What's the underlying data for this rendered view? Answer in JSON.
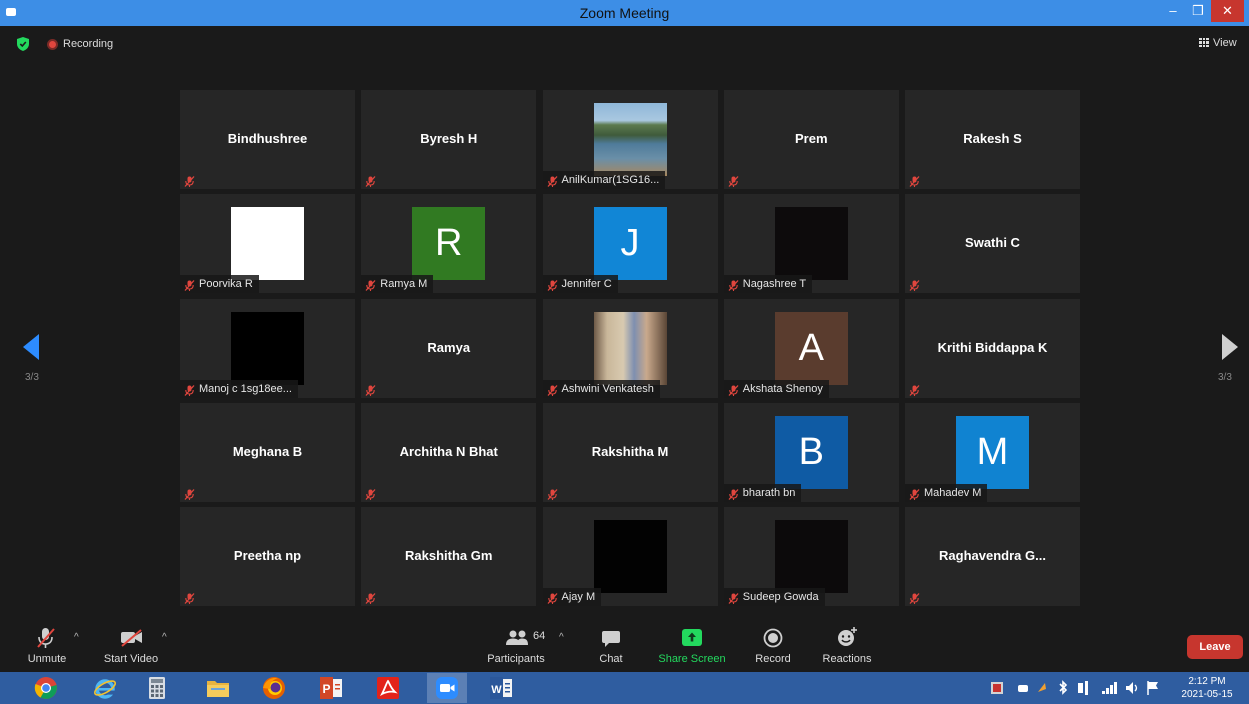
{
  "window": {
    "title": "Zoom Meeting",
    "minimize_label": "–",
    "maximize_label": "❒",
    "close_label": "✕"
  },
  "top_bar": {
    "recording_label": "Recording",
    "view_label": "View"
  },
  "pagination": {
    "left_label": "3/3",
    "right_label": "3/3"
  },
  "participants": [
    {
      "name": "Bindhushree",
      "display": "name"
    },
    {
      "name": "Byresh H",
      "display": "name"
    },
    {
      "name": "AnilKumar(1SG16...",
      "display": "photo"
    },
    {
      "name": "Prem",
      "display": "name"
    },
    {
      "name": "Rakesh S",
      "display": "name"
    },
    {
      "name": "Poorvika R",
      "display": "color",
      "color": "#ffffff"
    },
    {
      "name": "Ramya M",
      "display": "letter",
      "letter": "R",
      "color": "#317a22"
    },
    {
      "name": "Jennifer C",
      "display": "letter",
      "letter": "J",
      "color": "#1186d6"
    },
    {
      "name": "Nagashree T",
      "display": "color",
      "color": "#0d0b0c"
    },
    {
      "name": "Swathi C",
      "display": "name"
    },
    {
      "name": "Manoj c 1sg18ee...",
      "display": "color",
      "color": "#000000"
    },
    {
      "name": "Ramya",
      "display": "name"
    },
    {
      "name": "Ashwini Venkatesh",
      "display": "photo"
    },
    {
      "name": "Akshata Shenoy",
      "display": "letter",
      "letter": "A",
      "color": "#5a3c2e"
    },
    {
      "name": "Krithi Biddappa K",
      "display": "name"
    },
    {
      "name": "Meghana B",
      "display": "name"
    },
    {
      "name": "Architha N Bhat",
      "display": "name"
    },
    {
      "name": "Rakshitha M",
      "display": "name"
    },
    {
      "name": "bharath bn",
      "display": "letter",
      "letter": "B",
      "color": "#0f5ba4"
    },
    {
      "name": "Mahadev M",
      "display": "letter",
      "letter": "M",
      "color": "#1083d1"
    },
    {
      "name": "Preetha np",
      "display": "name"
    },
    {
      "name": "Rakshitha Gm",
      "display": "name"
    },
    {
      "name": "Ajay M",
      "display": "color",
      "color": "#020202"
    },
    {
      "name": "Sudeep Gowda",
      "display": "color",
      "color": "#0c0a0b"
    },
    {
      "name": "Raghavendra  G...",
      "display": "name"
    }
  ],
  "toolbar": {
    "unmute_label": "Unmute",
    "start_video_label": "Start Video",
    "participants_label": "Participants",
    "participants_count": "64",
    "chat_label": "Chat",
    "share_screen_label": "Share Screen",
    "record_label": "Record",
    "reactions_label": "Reactions",
    "leave_label": "Leave"
  },
  "taskbar": {
    "apps": [
      "chrome-icon",
      "internet-explorer-icon",
      "calculator-icon",
      "file-explorer-icon",
      "firefox-icon",
      "powerpoint-icon",
      "acrobat-icon",
      "zoom-icon",
      "word-icon"
    ],
    "time": "2:12 PM",
    "date": "2021-05-15"
  },
  "colors": {
    "accent_blue": "#2d8cff",
    "leave_red": "#c7362e",
    "share_green": "#23d95e",
    "mute_red": "#e0463e"
  }
}
